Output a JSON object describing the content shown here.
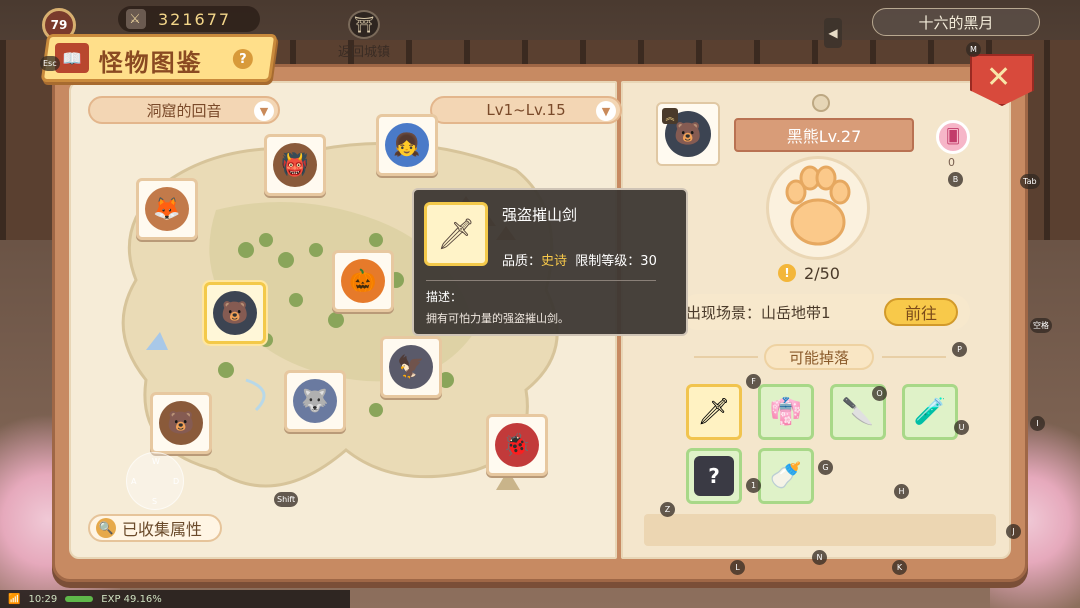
{
  "hud": {
    "player_level": "79",
    "esc_key": "Esc",
    "coins": "321677",
    "town_label": "返回城镇",
    "date": "十六的黑月",
    "m_key": "M"
  },
  "title": "怪物图鉴",
  "help_glyph": "?",
  "filters": {
    "area": "洞窟的回音",
    "level_range": "Lv1~Lv.15"
  },
  "map": {
    "monsters": [
      {
        "id": "fox",
        "glyph": "🦊",
        "color": "#c27a4a"
      },
      {
        "id": "caveman",
        "glyph": "👹",
        "color": "#8a5a3a"
      },
      {
        "id": "blue-hair-girl",
        "glyph": "👧",
        "color": "#4a7ac8"
      },
      {
        "id": "black-bear",
        "glyph": "🐻",
        "color": "#3c4452",
        "selected": true
      },
      {
        "id": "pumpkin-witch",
        "glyph": "🎃",
        "color": "#e67a2a"
      },
      {
        "id": "grey-wolf",
        "glyph": "🐺",
        "color": "#6a7aa0"
      },
      {
        "id": "brown-bear",
        "glyph": "🐻",
        "color": "#8a5a3a"
      },
      {
        "id": "bird-robot",
        "glyph": "🦅",
        "color": "#5a5a6a"
      },
      {
        "id": "red-bug",
        "glyph": "🐞",
        "color": "#c23a3a"
      }
    ],
    "collected_button": "已收集属性",
    "shift_key": "Shift"
  },
  "tooltip": {
    "item_name": "强盗摧山剑",
    "quality_label": "品质：",
    "quality_value": "史诗",
    "level_req": "限制等级：30",
    "desc_label": "描述：",
    "desc_text": "拥有可怕力量的强盗摧山剑。"
  },
  "detail": {
    "monster_name": "黑熊Lv.27",
    "card_count": "0",
    "progress": "2/50",
    "progress_fraction": 0.04,
    "location_label": "出现场景：山岳地带1",
    "goto_button": "前往",
    "drops_header": "可能掉落",
    "drops": [
      {
        "id": "sword-epic",
        "glyph": "🗡",
        "style": "gold"
      },
      {
        "id": "blue-armor",
        "glyph": "👘",
        "style": "green"
      },
      {
        "id": "red-dagger",
        "glyph": "🔪",
        "style": "green"
      },
      {
        "id": "purple-potion",
        "glyph": "🧪",
        "style": "green"
      },
      {
        "id": "mystery-item",
        "glyph": "?",
        "style": "green"
      },
      {
        "id": "milk-bottle",
        "glyph": "🍼",
        "style": "green"
      }
    ]
  },
  "keys": {
    "tab": "Tab",
    "b": "B",
    "p": "P",
    "f": "F",
    "o": "O",
    "u": "U",
    "z": "Z",
    "one": "1",
    "g": "G",
    "h": "H",
    "j": "J",
    "l": "L",
    "n": "N",
    "k": "K",
    "space": "空格",
    "i": "I",
    "w": "W",
    "a": "A",
    "s": "S",
    "d": "D"
  },
  "status": {
    "time": "10:29",
    "exp": "EXP 49.16%"
  },
  "colors": {
    "accent_gold": "#f8c94a",
    "epic_text": "#f7c84a",
    "book_border": "#c78a62",
    "close_red": "#d84a3c"
  }
}
